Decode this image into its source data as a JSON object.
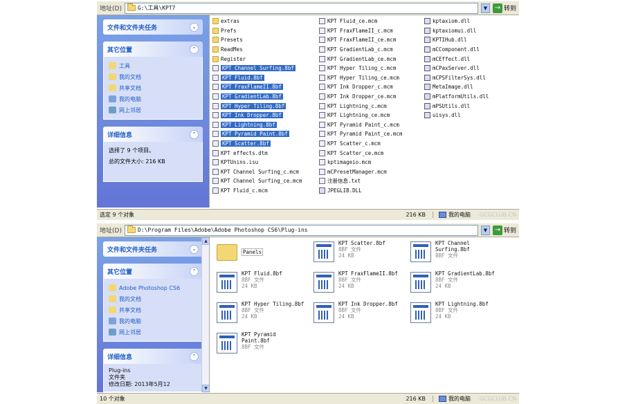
{
  "top": {
    "address_label": "地址(D)",
    "address_value": "G:\\工具\\KPT7",
    "go_label": "转到",
    "tasks": {
      "file_folder_tasks": "文件和文件夹任务",
      "other_places_title": "其它位置",
      "other_places": [
        "工具",
        "我的文档",
        "共享文档",
        "我的电脑",
        "网上邻居"
      ],
      "details_title": "详细信息",
      "details_lines": [
        "选择了 9 个项目。",
        "总的文件大小: 216 KB"
      ]
    },
    "files": {
      "col1": [
        {
          "name": "extras",
          "type": "folder",
          "selected": false
        },
        {
          "name": "Prefs",
          "type": "folder",
          "selected": false
        },
        {
          "name": "Presets",
          "type": "folder",
          "selected": false
        },
        {
          "name": "ReadMes",
          "type": "folder",
          "selected": false
        },
        {
          "name": "Register",
          "type": "folder",
          "selected": false
        },
        {
          "name": "KPT Channel Surfing.8bf",
          "type": "file",
          "selected": true
        },
        {
          "name": "KPT Fluid.8bf",
          "type": "file",
          "selected": true
        },
        {
          "name": "KPT FraxFlameII.8bf",
          "type": "file",
          "selected": true
        },
        {
          "name": "KPT GradientLab.8bf",
          "type": "file",
          "selected": true
        },
        {
          "name": "KPT Hyper Tiling.8bf",
          "type": "file",
          "selected": true
        },
        {
          "name": "KPT Ink Dropper.8bf",
          "type": "file",
          "selected": true
        },
        {
          "name": "KPT Lightning.8bf",
          "type": "file",
          "selected": true
        },
        {
          "name": "KPT Pyramid Paint.8bf",
          "type": "file",
          "selected": true
        },
        {
          "name": "KPT Scatter.8bf",
          "type": "file",
          "selected": true
        },
        {
          "name": "KPT effects.dtm",
          "type": "file",
          "selected": false
        },
        {
          "name": "KPTUnins.isu",
          "type": "file",
          "selected": false
        },
        {
          "name": "KPT Channel Surfing_c.mcm",
          "type": "file",
          "selected": false
        },
        {
          "name": "KPT Channel Surfing_ce.mcm",
          "type": "file",
          "selected": false
        },
        {
          "name": "KPT Fluid_c.mcm",
          "type": "file",
          "selected": false
        }
      ],
      "col2": [
        {
          "name": "KPT Fluid_ce.mcm",
          "type": "file"
        },
        {
          "name": "KPT FraxFlameII_c.mcm",
          "type": "file"
        },
        {
          "name": "KPT FraxFlameII_ce.mcm",
          "type": "file"
        },
        {
          "name": "KPT GradientLab_c.mcm",
          "type": "file"
        },
        {
          "name": "KPT GradientLab_ce.mcm",
          "type": "file"
        },
        {
          "name": "KPT Hyper Tiling_c.mcm",
          "type": "file"
        },
        {
          "name": "KPT Hyper Tiling_ce.mcm",
          "type": "file"
        },
        {
          "name": "KPT Ink Dropper_c.mcm",
          "type": "file"
        },
        {
          "name": "KPT Ink Dropper_ce.mcm",
          "type": "file"
        },
        {
          "name": "KPT Lightning_c.mcm",
          "type": "file"
        },
        {
          "name": "KPT Lightning_ce.mcm",
          "type": "file"
        },
        {
          "name": "KPT Pyramid Paint_c.mcm",
          "type": "file"
        },
        {
          "name": "KPT Pyramid Paint_ce.mcm",
          "type": "file"
        },
        {
          "name": "KPT Scatter_c.mcm",
          "type": "file"
        },
        {
          "name": "KPT Scatter_ce.mcm",
          "type": "file"
        },
        {
          "name": "kptimageio.mcm",
          "type": "file"
        },
        {
          "name": "mCPresetManager.mcm",
          "type": "file"
        },
        {
          "name": "注册信息.txt",
          "type": "file"
        },
        {
          "name": "JPEGLIB.DLL",
          "type": "dll"
        }
      ],
      "col3": [
        {
          "name": "kptaxiom.dll",
          "type": "dll"
        },
        {
          "name": "kptaxiomui.dll",
          "type": "dll"
        },
        {
          "name": "KPTIHub.dll",
          "type": "dll"
        },
        {
          "name": "mCComponent.dll",
          "type": "dll"
        },
        {
          "name": "mCEffect.dll",
          "type": "dll"
        },
        {
          "name": "mCPaxServer.dll",
          "type": "dll"
        },
        {
          "name": "mCPSFilterSys.dll",
          "type": "dll"
        },
        {
          "name": "MetaImage.dll",
          "type": "dll"
        },
        {
          "name": "mPlatformUtils.dll",
          "type": "dll"
        },
        {
          "name": "mPSUtils.dll",
          "type": "dll"
        },
        {
          "name": "uisys.dll",
          "type": "dll"
        }
      ]
    },
    "status": {
      "left": "选定 9 个对象",
      "size": "216 KB",
      "location": "我的电脑"
    }
  },
  "bottom": {
    "address_label": "地址(D)",
    "address_value": "D:\\Program Files\\Adobe\\Adobe Photoshop CS6\\Plug-ins",
    "go_label": "转到",
    "tasks": {
      "file_folder_tasks": "文件和文件夹任务",
      "other_places_title": "其它位置",
      "other_places": [
        "Adobe Photoshop CS6",
        "我的文档",
        "共享文档",
        "我的电脑",
        "网上邻居"
      ],
      "details_title": "详细信息",
      "details_lines": [
        "Plug-ins",
        "文件夹",
        "修改日期: 2013年5月12"
      ]
    },
    "tiles": [
      {
        "name": "Panels",
        "type": "folder",
        "line2": "",
        "line3": ""
      },
      {
        "name": "KPT Scatter.8bf",
        "type": "file",
        "line2": "8BF 文件",
        "line3": "24 KB"
      },
      {
        "name": "KPT Channel Surfing.8bf",
        "type": "file",
        "line2": "8BF 文件",
        "line3": ""
      },
      {
        "name": "KPT Fluid.8bf",
        "type": "file",
        "line2": "8BF 文件",
        "line3": "24 KB"
      },
      {
        "name": "KPT FraxFlameII.8bf",
        "type": "file",
        "line2": "8BF 文件",
        "line3": "24 KB"
      },
      {
        "name": "KPT GradientLab.8bf",
        "type": "file",
        "line2": "8BF 文件",
        "line3": "24 KB"
      },
      {
        "name": "KPT Hyper Tiling.8bf",
        "type": "file",
        "line2": "8BF 文件",
        "line3": "24 KB"
      },
      {
        "name": "KPT Ink Dropper.8bf",
        "type": "file",
        "line2": "8BF 文件",
        "line3": "24 KB"
      },
      {
        "name": "KPT Lightning.8bf",
        "type": "file",
        "line2": "8BF 文件",
        "line3": "24 KB"
      },
      {
        "name": "KPT Pyramid Paint.8bf",
        "type": "file",
        "line2": "8BF 文件",
        "line3": ""
      }
    ],
    "status": {
      "left": "10 个对象",
      "size": "216 KB",
      "location": "我的电脑"
    }
  },
  "watermark": "GCGCLUB.CN"
}
